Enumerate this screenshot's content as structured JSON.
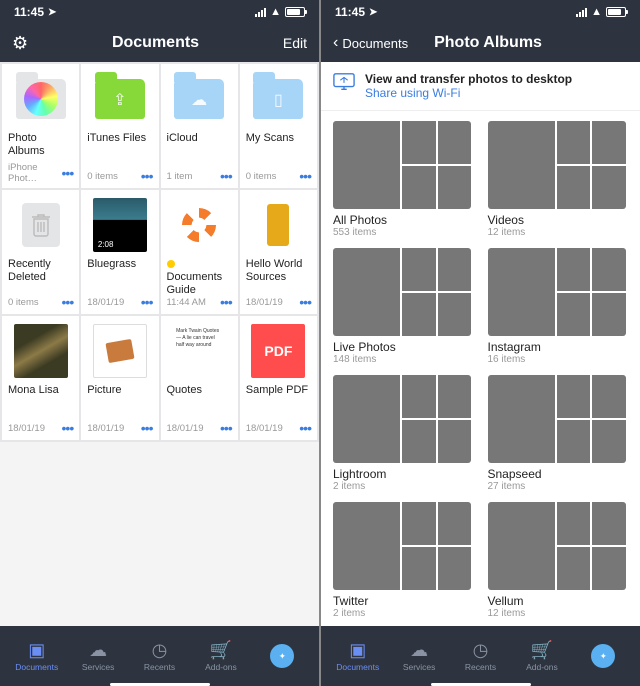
{
  "status": {
    "time": "11:45",
    "loc_glyph": "➤"
  },
  "left": {
    "nav": {
      "title": "Documents",
      "edit": "Edit"
    },
    "docs": [
      {
        "title": "Photo Albums",
        "meta": "iPhone Phot…",
        "type": "photos"
      },
      {
        "title": "iTunes Files",
        "meta": "0 items",
        "type": "folder-green",
        "glyph": "⇪"
      },
      {
        "title": "iCloud",
        "meta": "1 item",
        "type": "folder-blue",
        "glyph": "☁"
      },
      {
        "title": "My Scans",
        "meta": "0 items",
        "type": "folder-blue",
        "glyph": "▯"
      },
      {
        "title": "Recently Deleted",
        "meta": "0 items",
        "type": "trash"
      },
      {
        "title": "Bluegrass",
        "meta": "18/01/19",
        "type": "bluegrass",
        "badge": "2:08"
      },
      {
        "title": "Documents Guide",
        "meta": "11:44 AM",
        "type": "lifesaver",
        "prefix_bullet": true
      },
      {
        "title": "Hello World Sources",
        "meta": "18/01/19",
        "type": "zip"
      },
      {
        "title": "Mona Lisa",
        "meta": "18/01/19",
        "type": "monalisa"
      },
      {
        "title": "Picture",
        "meta": "18/01/19",
        "type": "picture"
      },
      {
        "title": "Quotes",
        "meta": "18/01/19",
        "type": "quotes",
        "quotes_text": "Mark Twain Quotes — A lie can travel half way around"
      },
      {
        "title": "Sample PDF",
        "meta": "18/01/19",
        "type": "pdf",
        "pdf_label": "PDF"
      }
    ]
  },
  "right": {
    "nav": {
      "back": "Documents",
      "title": "Photo Albums"
    },
    "banner": {
      "title": "View and transfer photos to desktop",
      "link": "Share using Wi-Fi"
    },
    "albums": [
      {
        "title": "All Photos",
        "meta": "553 items",
        "cls": "p"
      },
      {
        "title": "Videos",
        "meta": "12 items",
        "cls": "v"
      },
      {
        "title": "Live Photos",
        "meta": "148 items",
        "cls": "l"
      },
      {
        "title": "Instagram",
        "meta": "16 items",
        "cls": "i"
      },
      {
        "title": "Lightroom",
        "meta": "2 items",
        "cls": "r"
      },
      {
        "title": "Snapseed",
        "meta": "27 items",
        "cls": "s"
      },
      {
        "title": "Twitter",
        "meta": "2 items",
        "cls": "t"
      },
      {
        "title": "Vellum",
        "meta": "12 items",
        "cls": "w"
      }
    ]
  },
  "tabs": [
    {
      "label": "Documents",
      "name": "documents-tab",
      "glyph": "▣",
      "active": true
    },
    {
      "label": "Services",
      "name": "services-tab",
      "glyph": "☁",
      "active": false
    },
    {
      "label": "Recents",
      "name": "recents-tab",
      "glyph": "◷",
      "active": false
    },
    {
      "label": "Add-ons",
      "name": "addons-tab",
      "glyph": "🛒",
      "active": false
    },
    {
      "label": "",
      "name": "browser-tab",
      "glyph": "✦",
      "active": false,
      "safari": true
    }
  ]
}
